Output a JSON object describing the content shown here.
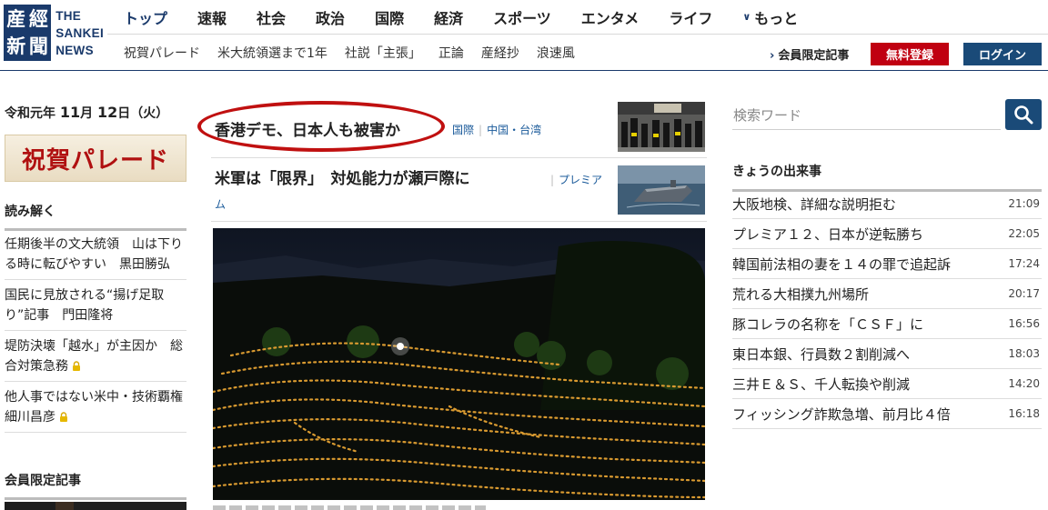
{
  "logo": {
    "kanji": [
      "産",
      "經",
      "新",
      "聞"
    ],
    "text_lines": [
      "THE",
      "SANKEI",
      "NEWS"
    ]
  },
  "nav_main": [
    {
      "label": "トップ"
    },
    {
      "label": "速報"
    },
    {
      "label": "社会"
    },
    {
      "label": "政治"
    },
    {
      "label": "国際"
    },
    {
      "label": "経済"
    },
    {
      "label": "スポーツ"
    },
    {
      "label": "エンタメ"
    },
    {
      "label": "ライフ"
    }
  ],
  "nav_more": "もっと",
  "nav_sub": [
    {
      "label": "祝賀パレード"
    },
    {
      "label": "米大統領選まで1年"
    },
    {
      "label": "社説「主張」"
    },
    {
      "label": "正論"
    },
    {
      "label": "産経抄"
    },
    {
      "label": "浪速風"
    }
  ],
  "header_actions": {
    "member_link": "会員限定記事",
    "register": "無料登録",
    "login": "ログイン"
  },
  "left": {
    "date_prefix": "令和元年",
    "date_month": "11",
    "date_month_unit": "月",
    "date_day": "12",
    "date_day_unit": "日",
    "date_weekday": "（火）",
    "banner": "祝賀パレード",
    "read_heading": "読み解く",
    "read_items": [
      {
        "text": "任期後半の文大統領　山は下りる時に転びやすい　黒田勝弘",
        "locked": false
      },
      {
        "text": "国民に見放される“揚げ足取り”記事　門田隆将",
        "locked": false
      },
      {
        "text": "堤防決壊「越水」が主因か　総合対策急務",
        "locked": true
      },
      {
        "text": "他人事ではない米中・技術覇権　細川昌彦",
        "locked": true
      }
    ],
    "members_heading": "会員限定記事"
  },
  "center": {
    "headline1": {
      "title": "香港デモ、日本人も被害か",
      "tags": [
        "国際",
        "中国・台湾"
      ]
    },
    "headline2": {
      "title": "米軍は「限界」　対処能力が瀬戸際に",
      "tag_line1": "プレミア",
      "tag_line2": "ム"
    }
  },
  "right": {
    "search_placeholder": "検索ワード",
    "events_heading": "きょうの出来事",
    "events": [
      {
        "title": "大阪地検、詳細な説明拒む",
        "time": "21:09"
      },
      {
        "title": "プレミア１２、日本が逆転勝ち",
        "time": "22:05"
      },
      {
        "title": "韓国前法相の妻を１４の罪で追起訴",
        "time": "17:24"
      },
      {
        "title": "荒れる大相撲九州場所",
        "time": "20:17"
      },
      {
        "title": "豚コレラの名称を「ＣＳＦ」に",
        "time": "16:56"
      },
      {
        "title": "東日本銀、行員数２割削減へ",
        "time": "18:03"
      },
      {
        "title": "三井Ｅ＆Ｓ、千人転換や削減",
        "time": "14:20"
      },
      {
        "title": "フィッシング詐欺急増、前月比４倍",
        "time": "16:18"
      }
    ]
  },
  "colors": {
    "brand_navy": "#1a3a6b",
    "register_red": "#c00011",
    "login_blue": "#1a4a78",
    "link_blue": "#1a5a9a",
    "highlight_circle": "#c01010"
  }
}
